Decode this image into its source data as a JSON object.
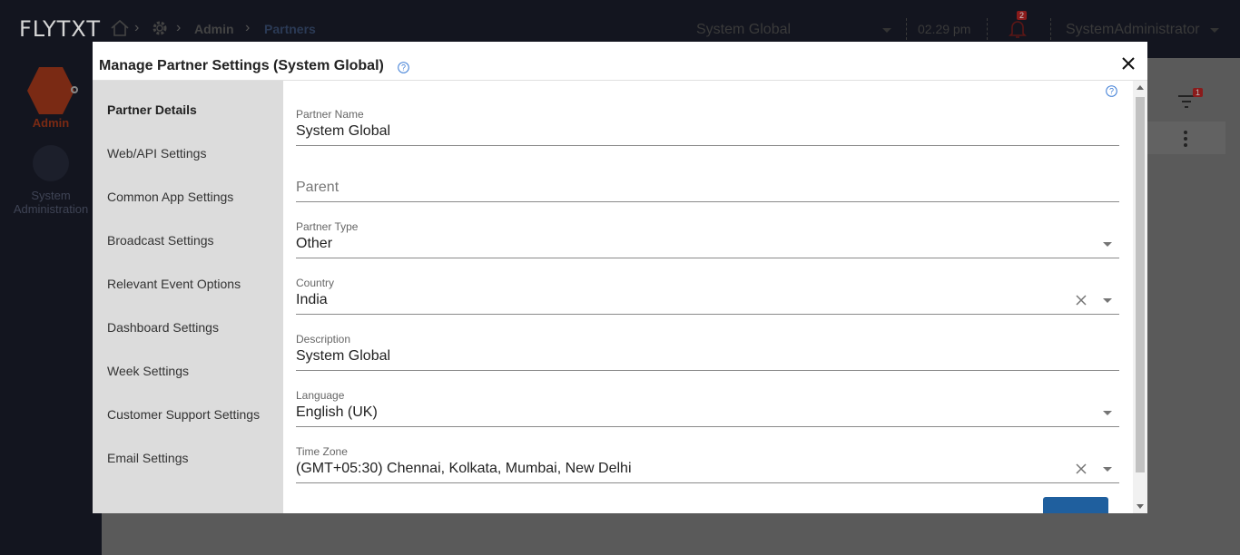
{
  "app": {
    "logo": "FLYTXT",
    "breadcrumb": [
      "Admin",
      "Partners"
    ],
    "partner_selector": "System Global",
    "time": "02.29 pm",
    "notification_count": "2",
    "user": "SystemAdministrator",
    "filter_badge": "1",
    "left_nav": [
      {
        "label": "Admin",
        "icon": "admin-icon",
        "active": true
      },
      {
        "label": "System Administration",
        "icon": "system-admin-icon",
        "active": false
      }
    ]
  },
  "modal": {
    "title": "Manage Partner Settings (System Global)",
    "sidebar": [
      {
        "label": "Partner Details",
        "active": true
      },
      {
        "label": "Web/API Settings"
      },
      {
        "label": "Common App Settings"
      },
      {
        "label": "Broadcast Settings"
      },
      {
        "label": "Relevant Event Options"
      },
      {
        "label": "Dashboard Settings"
      },
      {
        "label": "Week Settings"
      },
      {
        "label": "Customer Support Settings"
      },
      {
        "label": "Email Settings"
      }
    ],
    "fields": {
      "partner_name": {
        "label": "Partner Name",
        "value": "System Global"
      },
      "parent": {
        "placeholder": "Parent"
      },
      "partner_type": {
        "label": "Partner Type",
        "value": "Other"
      },
      "country": {
        "label": "Country",
        "value": "India"
      },
      "description": {
        "label": "Description",
        "value": "System Global"
      },
      "language": {
        "label": "Language",
        "value": "English (UK)"
      },
      "time_zone": {
        "label": "Time Zone",
        "value": "(GMT+05:30) Chennai, Kolkata, Mumbai, New Delhi"
      }
    }
  },
  "colors": {
    "accent": "#1f5f9e",
    "admin_hex": "#e05a2b",
    "help_icon": "#3a7bd5"
  }
}
